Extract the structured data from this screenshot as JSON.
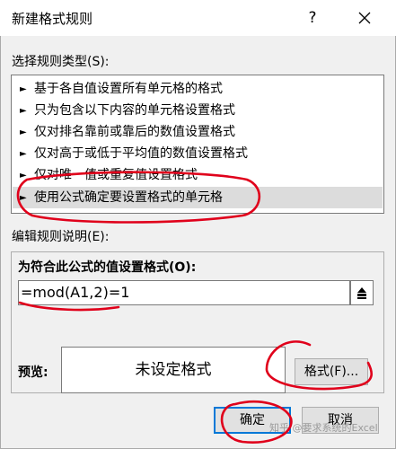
{
  "dialog": {
    "title": "新建格式规则",
    "help_label": "?",
    "close_icon": "close-icon"
  },
  "rule_type": {
    "label": "选择规则类型(S):",
    "items": [
      {
        "label": "基于各自值设置所有单元格的格式"
      },
      {
        "label": "只为包含以下内容的单元格设置格式"
      },
      {
        "label": "仅对排名靠前或靠后的数值设置格式"
      },
      {
        "label": "仅对高于或低于平均值的数值设置格式"
      },
      {
        "label": "仅对唯一值或重复值设置格式"
      },
      {
        "label": "使用公式确定要设置格式的单元格"
      }
    ],
    "selected_index": 5,
    "arrow_glyph": "►"
  },
  "description": {
    "label": "编辑规则说明(E):",
    "formula_label": "为符合此公式的值设置格式(O):",
    "formula_value": "=mod(A1,2)=1",
    "collapse_icon": "collapse-dialog-icon",
    "preview_label": "预览:",
    "preview_text": "未设定格式",
    "format_button": "格式(F)..."
  },
  "footer": {
    "ok_label": "确定",
    "cancel_label": "取消",
    "watermark": "知乎 @要求系统的Excel"
  },
  "colors": {
    "annotation_red": "#e0001b",
    "selected_bg": "#dcdcdc",
    "default_button_border": "#0078d7"
  }
}
